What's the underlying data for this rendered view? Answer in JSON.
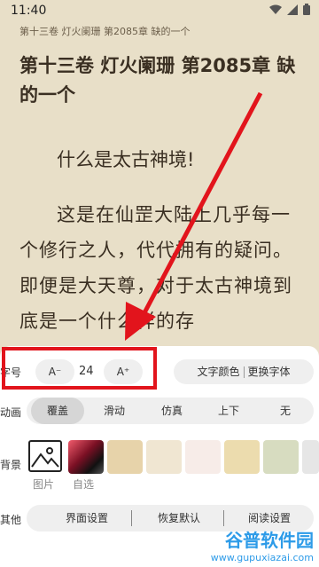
{
  "status": {
    "time": "11:40",
    "icons": [
      "wifi-icon",
      "signal-icon",
      "battery-icon"
    ]
  },
  "reader": {
    "chapter_header": "第十三卷 灯火阑珊 第2085章 缺的一个",
    "chapter_title": "第十三卷 灯火阑珊 第2085章 缺的一个",
    "paragraphs": [
      "什么是太古神境!",
      "这是在仙罡大陆上几乎每一个修行之人，代代拥有的疑问。即便是大天尊，对于太古神境到底是一个什么样的存"
    ]
  },
  "settings": {
    "font_size": {
      "label": "字号",
      "minus": "A⁻",
      "value": "24",
      "plus": "A⁺"
    },
    "font_color": "文字颜色",
    "change_font": "更换字体",
    "animation": {
      "label": "动画",
      "options": [
        "覆盖",
        "滑动",
        "仿真",
        "上下",
        "无"
      ],
      "selected": "覆盖"
    },
    "background": {
      "label": "背景",
      "picture_caption": "图片",
      "custom_caption": "自选",
      "swatches": [
        "#e7d3aa",
        "#f0e6d2",
        "#f7ece8",
        "#ecdcae",
        "#d7dcc0",
        "#e6e6e6"
      ]
    },
    "other": {
      "label": "其他",
      "options": [
        "界面设置",
        "恢复默认",
        "阅读设置"
      ]
    }
  },
  "watermark": {
    "main": "谷普软件园",
    "sub": "www.gupuxiazai.com"
  },
  "colors": {
    "highlight": "#e2141c",
    "paper": "#e8dfc8",
    "panel": "#ffffff"
  }
}
